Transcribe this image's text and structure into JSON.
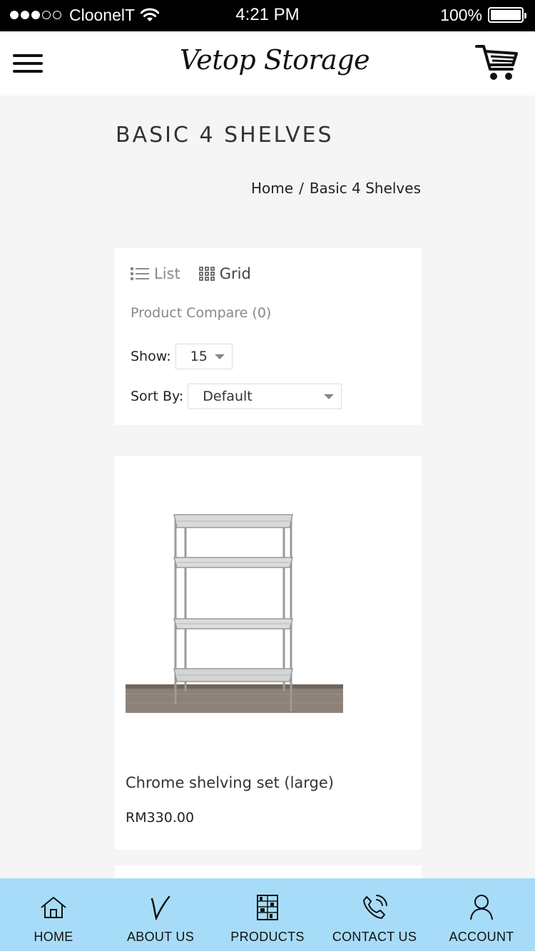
{
  "status_bar": {
    "carrier": "CloonelT",
    "time": "4:21 PM",
    "battery": "100%",
    "battery_level": 1.0,
    "signal_dots_filled": 3,
    "signal_dots_total": 5
  },
  "header": {
    "logo": "Vetop Storage",
    "menu_icon": "hamburger-icon",
    "cart_icon": "cart-icon"
  },
  "page": {
    "title": "BASIC 4 SHELVES",
    "breadcrumb": [
      "Home",
      "Basic 4 Shelves"
    ],
    "breadcrumb_separator": "/"
  },
  "toolbar": {
    "list_label": "List",
    "grid_label": "Grid",
    "compare_label": "Product Compare (0)",
    "show_label": "Show:",
    "show_value": "15",
    "sort_label": "Sort By:",
    "sort_value": "Default"
  },
  "products": [
    {
      "name": "Chrome shelving set (large)",
      "price": "RM330.00"
    }
  ],
  "bottom_nav": [
    {
      "label": "HOME",
      "icon": "home-icon"
    },
    {
      "label": "ABOUT US",
      "icon": "about-v-icon"
    },
    {
      "label": "PRODUCTS",
      "icon": "shelf-icon"
    },
    {
      "label": "CONTACT US",
      "icon": "phone-icon"
    },
    {
      "label": "ACCOUNT",
      "icon": "user-icon"
    }
  ],
  "colors": {
    "status_bar_bg": "#000000",
    "page_bg": "#f5f5f5",
    "bottom_nav_bg": "#a7dcf8"
  }
}
